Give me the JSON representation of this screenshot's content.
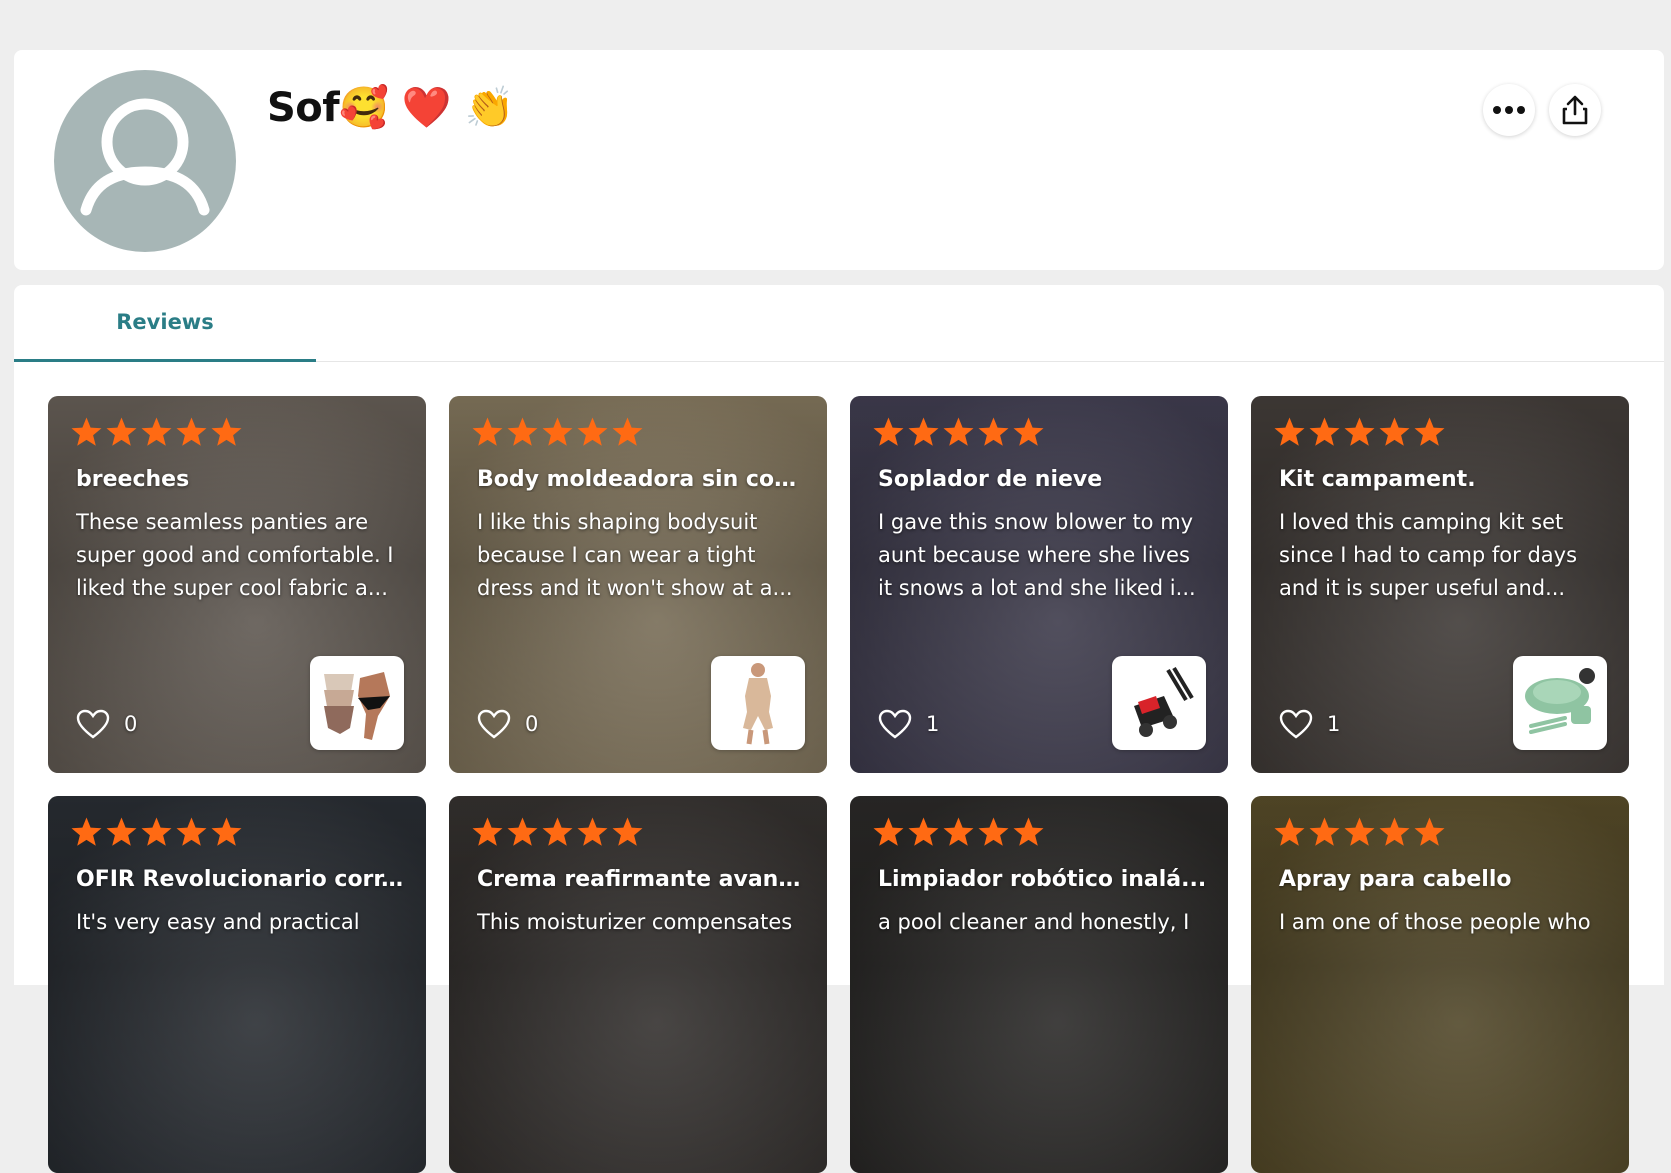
{
  "profile": {
    "name": "Sof🥰 ❤️ 👏",
    "avatar_icon": "user-silhouette-icon",
    "more_icon": "more-dots-icon",
    "share_icon": "share-icon"
  },
  "tabs": [
    {
      "label": "Reviews",
      "active": true
    }
  ],
  "colors": {
    "accent": "#2a7d86",
    "star": "#ff6a13",
    "avatar_bg": "#a7b6b6"
  },
  "reviews": [
    {
      "rating": 5,
      "title": "breeches",
      "snippet": "These seamless panties are super good and comfortable. I liked the super cool fabric a...",
      "likes": "0",
      "photo_bg": "#8f8479",
      "thumb_icon": "panties-product-icon"
    },
    {
      "rating": 5,
      "title": "Body moldeadora sin cos...",
      "snippet": "I like this shaping bodysuit because I can wear a tight dress and it won't show at a...",
      "likes": "0",
      "photo_bg": "#b7a582",
      "thumb_icon": "bodysuit-product-icon"
    },
    {
      "rating": 5,
      "title": "Soplador de nieve",
      "snippet": "I gave this snow blower to my aunt because where she lives it snows a lot and she liked i...",
      "likes": "1",
      "photo_bg": "#5a5670",
      "thumb_icon": "snow-blower-product-icon"
    },
    {
      "rating": 5,
      "title": "Kit campament.",
      "snippet": "I loved this camping kit set since I had to camp for days and it is super useful and...",
      "likes": "1",
      "photo_bg": "#5d5550",
      "thumb_icon": "camping-kit-product-icon"
    },
    {
      "rating": 5,
      "title": "OFIR Revolucionario corr...",
      "snippet": "It's very easy and practical",
      "likes": "",
      "photo_bg": "#3a4048",
      "thumb_icon": ""
    },
    {
      "rating": 5,
      "title": "Crema reafirmante avanz...",
      "snippet": "This moisturizer compensates",
      "likes": "",
      "photo_bg": "#4a4542",
      "thumb_icon": ""
    },
    {
      "rating": 5,
      "title": "Limpiador robótico inalá...",
      "snippet": "a pool cleaner and honestly, I",
      "likes": "",
      "photo_bg": "#3c3a38",
      "thumb_icon": ""
    },
    {
      "rating": 5,
      "title": "Apray para cabello",
      "snippet": "I am one of those people who",
      "likes": "",
      "photo_bg": "#7a6a3a",
      "thumb_icon": ""
    }
  ]
}
